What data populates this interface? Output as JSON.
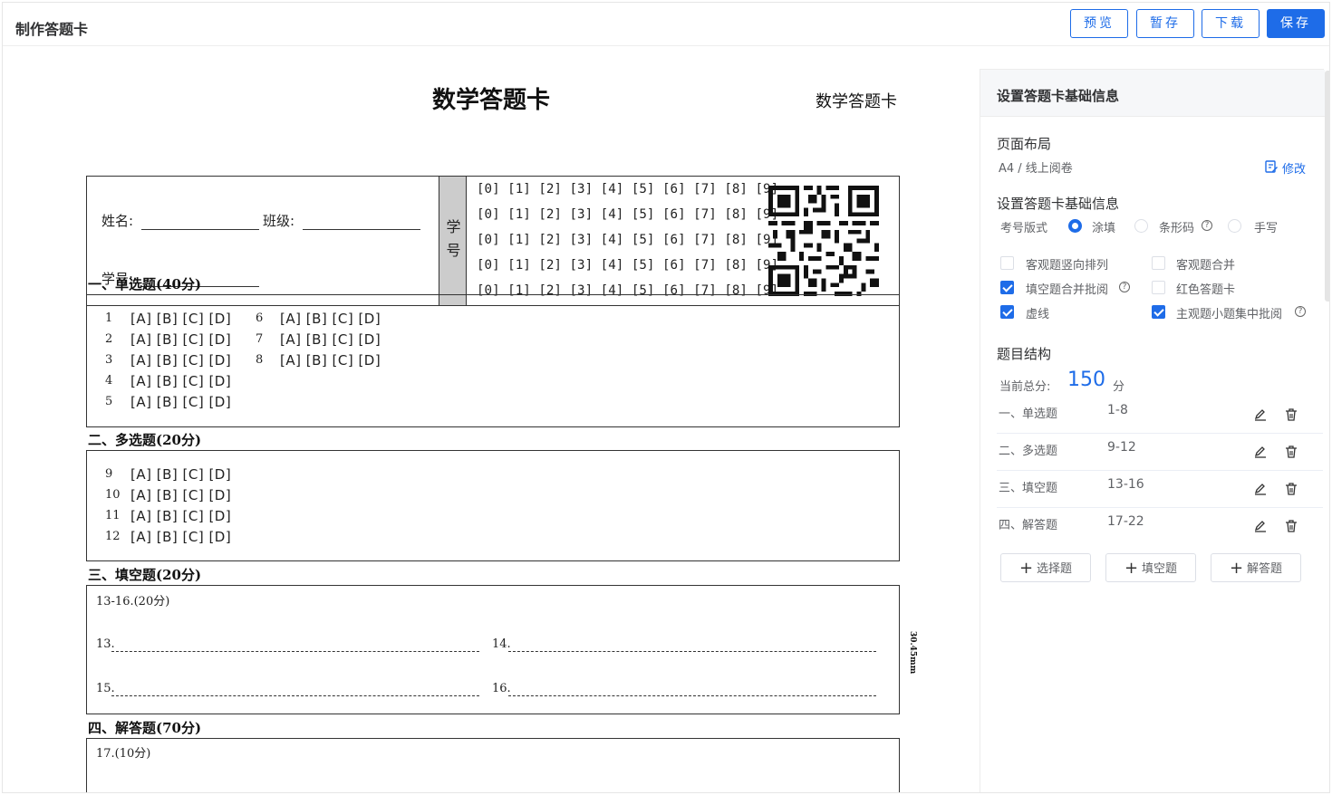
{
  "app": {
    "title": "制作答题卡"
  },
  "toolbar": {
    "preview": "预览",
    "draft": "暂存",
    "download": "下载",
    "save": "保存"
  },
  "sheet": {
    "title": "数学答题卡",
    "subtitle": "数学答题卡",
    "name_label": "姓名:",
    "class_label": "班级:",
    "id_label": "学号:",
    "xuehao_chars": [
      "学",
      "号"
    ],
    "digit_row": "[0] [1] [2] [3] [4] [5] [6] [7] [8] [9]",
    "sections": [
      {
        "title": "一、单选题(40分)"
      },
      {
        "title": "二、多选题(20分)"
      },
      {
        "title": "三、填空题(20分)"
      },
      {
        "title": "四、解答题(70分)"
      }
    ],
    "options": "[A] [B] [C] [D]",
    "q": [
      "1",
      "2",
      "3",
      "4",
      "5",
      "6",
      "7",
      "8",
      "9",
      "10",
      "11",
      "12"
    ],
    "fill_header": "13-16.(20分)",
    "fill_items": [
      "13.",
      "14.",
      "15.",
      "16."
    ],
    "side_mm": "30.45mm",
    "answer_header": "17.(10分)"
  },
  "panel": {
    "header": "设置答题卡基础信息",
    "layout_label": "页面布局",
    "layout_value": "A4 / 线上阅卷",
    "modify": "修改",
    "basic_label": "设置答题卡基础信息",
    "id_style_label": "考号版式",
    "id_style_options": [
      "涂填",
      "条形码",
      "手写"
    ],
    "id_style_selected": 0,
    "checkboxes": [
      {
        "label": "客观题竖向排列",
        "checked": false
      },
      {
        "label": "客观题合并",
        "checked": false
      },
      {
        "label": "填空题合并批阅",
        "checked": true
      },
      {
        "label": "红色答题卡",
        "checked": false
      },
      {
        "label": "虚线",
        "checked": true
      },
      {
        "label": "主观题小题集中批阅",
        "checked": true
      }
    ],
    "structure_label": "题目结构",
    "total_label": "当前总分:",
    "total_value": "150",
    "total_unit": "分",
    "structure": [
      {
        "name": "一、单选题",
        "range": "1-8"
      },
      {
        "name": "二、多选题",
        "range": "9-12"
      },
      {
        "name": "三、填空题",
        "range": "13-16"
      },
      {
        "name": "四、解答题",
        "range": "17-22"
      }
    ],
    "add_buttons": [
      "选择题",
      "填空题",
      "解答题"
    ]
  }
}
